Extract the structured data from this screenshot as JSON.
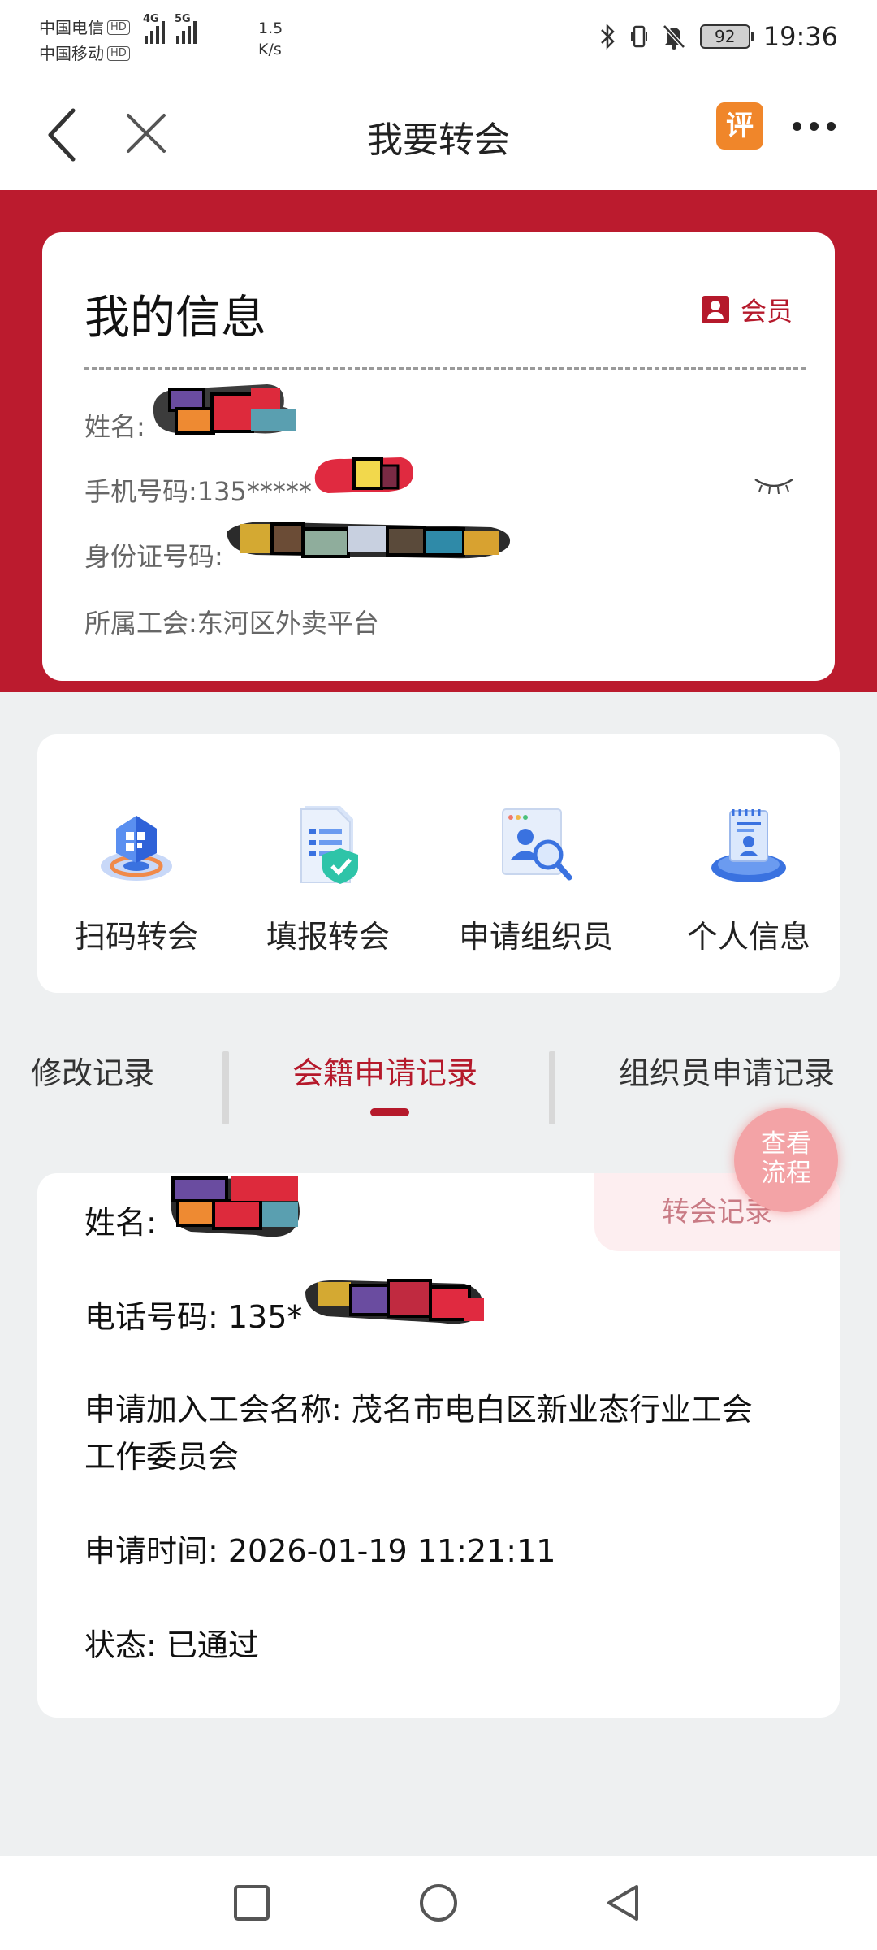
{
  "status_bar": {
    "carrier1": "中国电信",
    "carrier2": "中国移动",
    "hd": "HD",
    "net1": "4G",
    "net2": "5G",
    "speed_value": "1.5",
    "speed_unit": "K/s",
    "battery": "92",
    "time": "19:36"
  },
  "nav": {
    "title": "我要转会",
    "eval_label": "评"
  },
  "info_card": {
    "title": "我的信息",
    "member_label": "会员",
    "name_label": "姓名:",
    "phone_label": "手机号码:",
    "phone_visible": "135*****",
    "id_label": "身份证号码:",
    "union_label": "所属工会:",
    "union_value": "东河区外卖平台"
  },
  "actions": [
    {
      "label": "扫码转会",
      "icon": "qr-scan-icon"
    },
    {
      "label": "填报转会",
      "icon": "form-shield-icon"
    },
    {
      "label": "申请组织员",
      "icon": "profile-search-icon"
    },
    {
      "label": "个人信息",
      "icon": "personal-info-icon"
    }
  ],
  "tabs": [
    {
      "label": "修改记录",
      "active": false
    },
    {
      "label": "会籍申请记录",
      "active": true
    },
    {
      "label": "组织员申请记录",
      "active": false
    }
  ],
  "record": {
    "tag": "转会记录",
    "name_label": "姓名: ",
    "phone_label": "电话号码: 135*",
    "union_line1": "申请加入工会名称: 茂名市电白区新业态行业工会",
    "union_line2": "工作委员会",
    "time": "申请时间: 2026-01-19 11:21:11",
    "status": "状态: 已通过"
  },
  "flow_button": {
    "line1": "查看",
    "line2": "流程"
  },
  "colors": {
    "brand_red": "#bb1b2e",
    "accent_red": "#b5192b",
    "background": "#eef0f1"
  }
}
